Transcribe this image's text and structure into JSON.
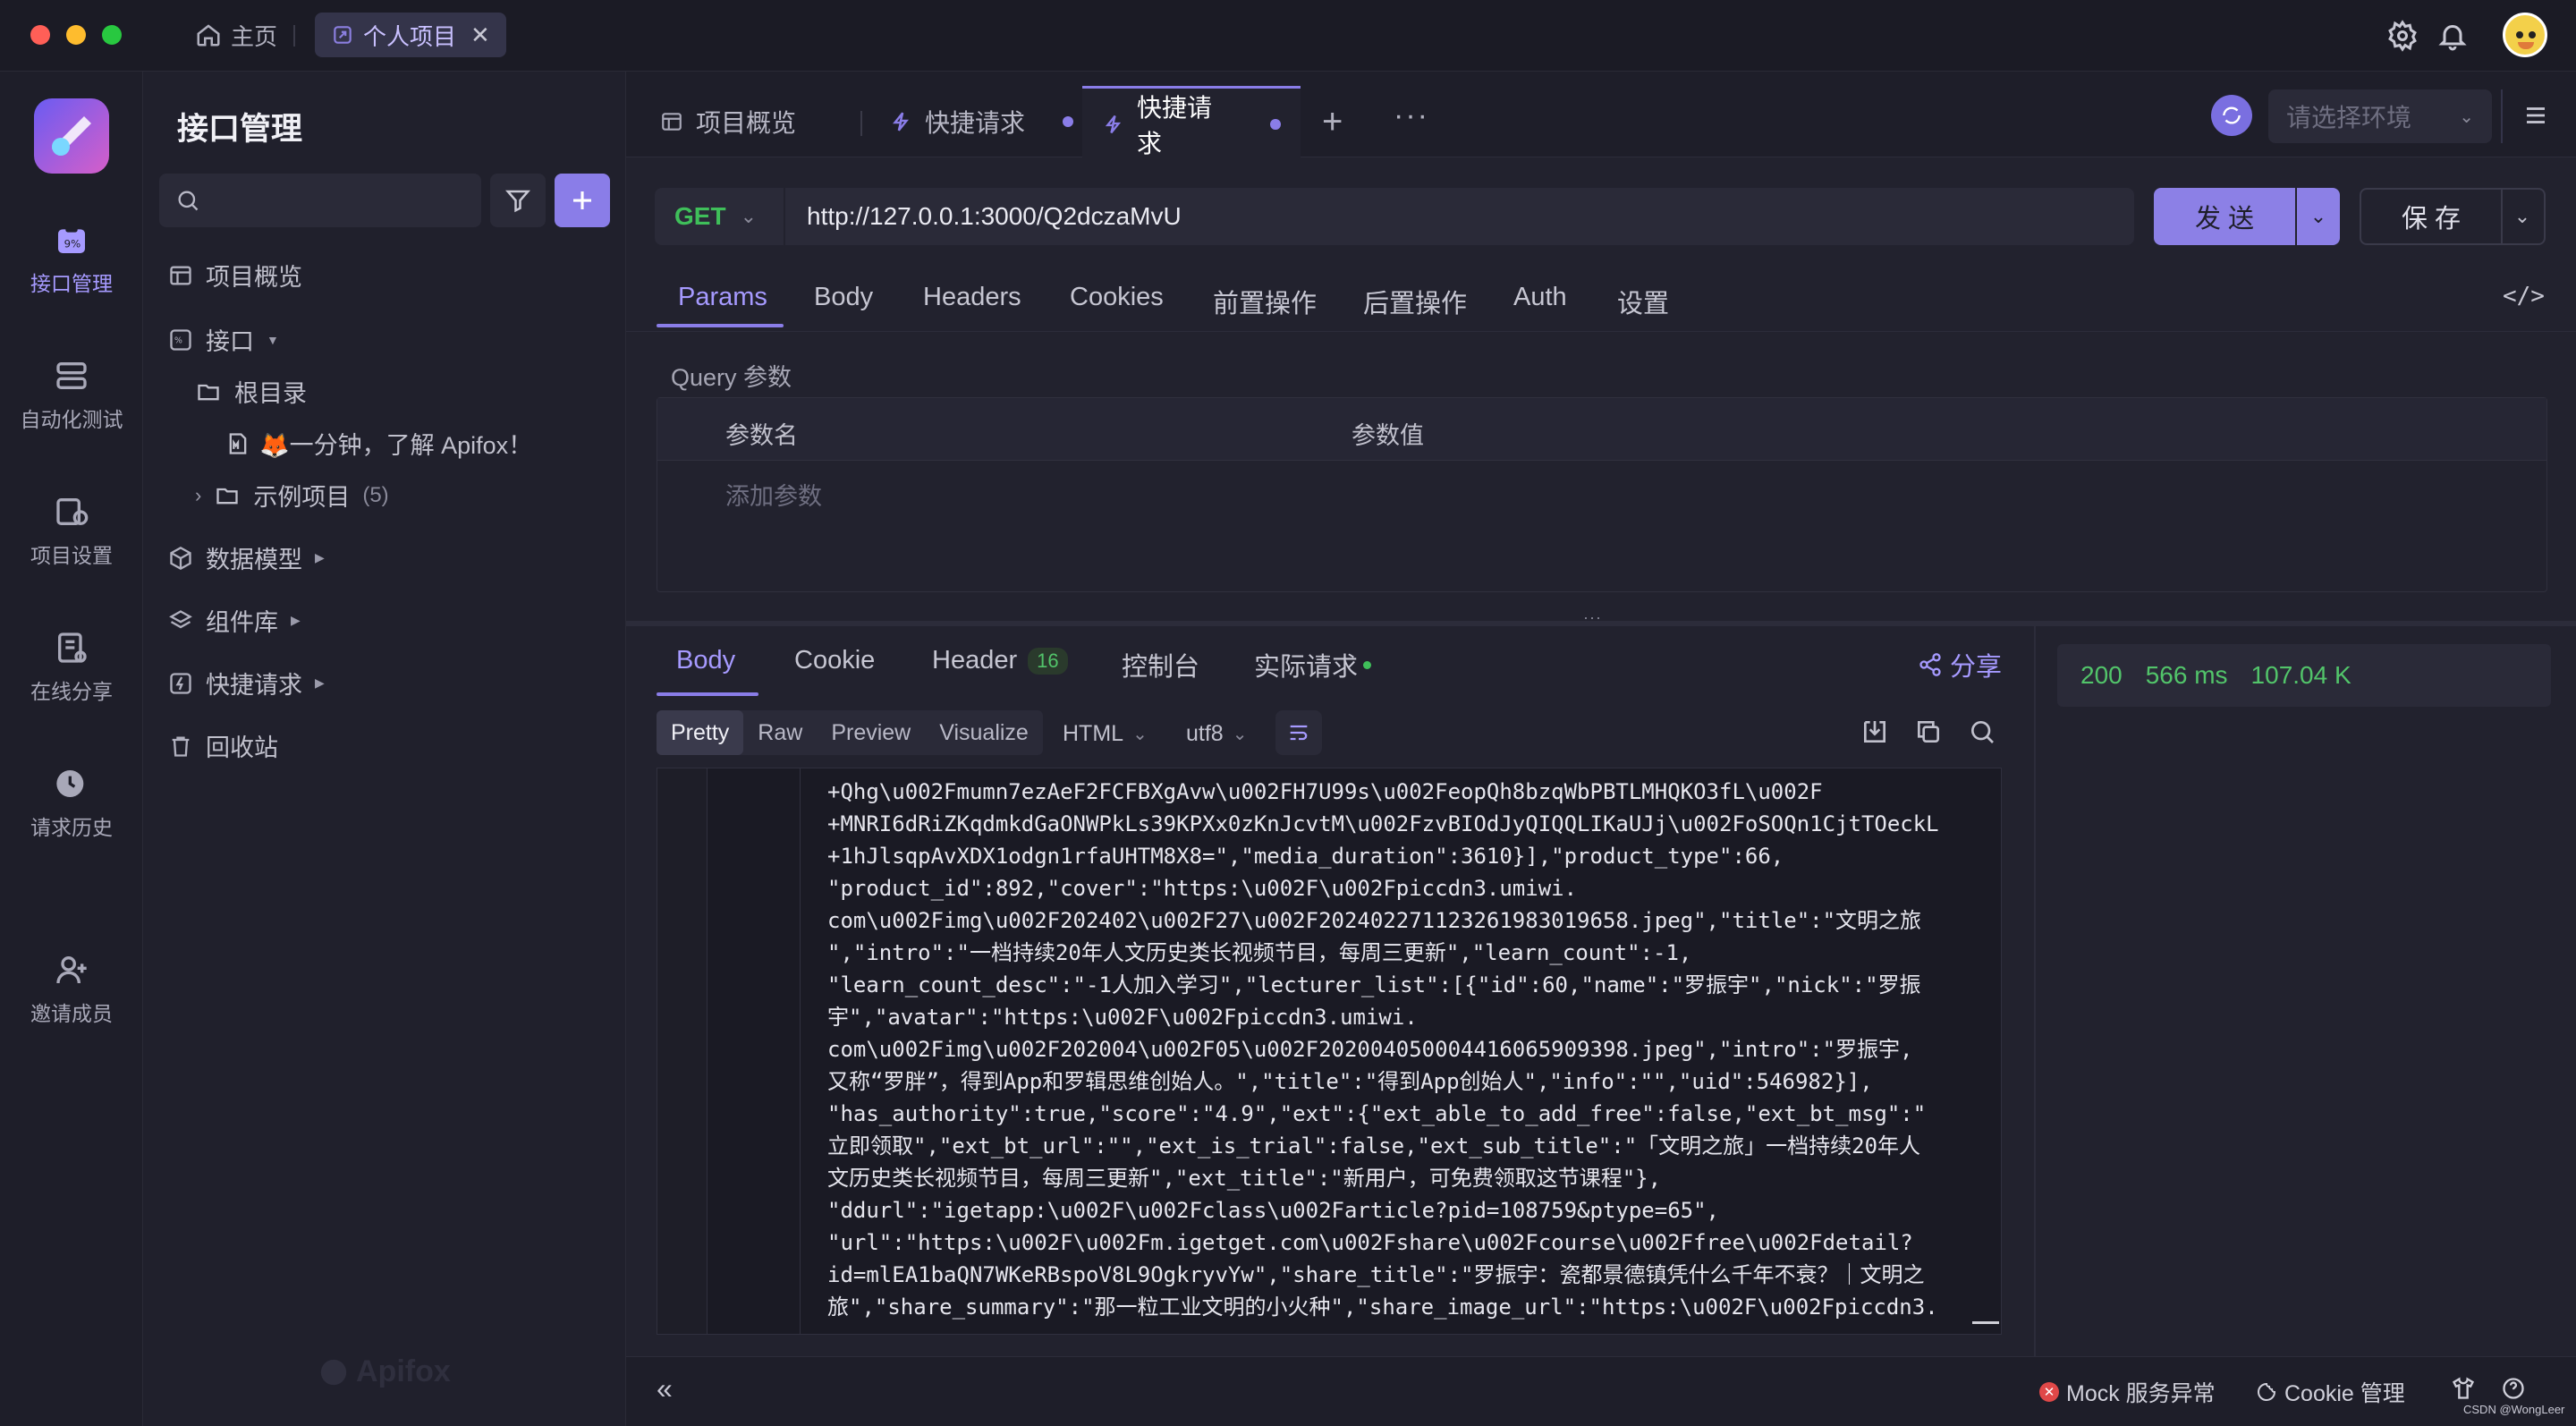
{
  "titlebar": {
    "home_tab": "主页",
    "project_tab": "个人项目"
  },
  "rail": {
    "items": [
      {
        "label": "接口管理",
        "icon": "api-management-icon"
      },
      {
        "label": "自动化测试",
        "icon": "automation-test-icon"
      },
      {
        "label": "项目设置",
        "icon": "project-settings-icon"
      },
      {
        "label": "在线分享",
        "icon": "online-share-icon"
      },
      {
        "label": "请求历史",
        "icon": "request-history-icon"
      },
      {
        "label": "邀请成员",
        "icon": "invite-member-icon"
      }
    ]
  },
  "sidebar": {
    "title": "接口管理",
    "search_placeholder": "",
    "items": {
      "overview": "项目概览",
      "api": "接口",
      "root": "根目录",
      "doc": "🦊一分钟，了解 Apifox！",
      "examples": "示例项目",
      "examples_count": "(5)",
      "data_models": "数据模型",
      "components": "组件库",
      "quick_requests": "快捷请求",
      "recycle": "回收站"
    },
    "watermark": "Apifox"
  },
  "main": {
    "tabs": {
      "overview": "项目概览",
      "quick1": "快捷请求",
      "quick2": "快捷请求"
    },
    "env_placeholder": "请选择环境",
    "request": {
      "method": "GET",
      "url": "http://127.0.0.1:3000/Q2dczaMvU",
      "send": "发 送",
      "save": "保 存"
    },
    "req_tabs": [
      "Params",
      "Body",
      "Headers",
      "Cookies",
      "前置操作",
      "后置操作",
      "Auth",
      "设置"
    ],
    "query_label": "Query 参数",
    "table": {
      "col_name": "参数名",
      "col_value": "参数值",
      "add_placeholder": "添加参数"
    },
    "resp_tabs": {
      "body": "Body",
      "cookie": "Cookie",
      "header": "Header",
      "header_count": "16",
      "console": "控制台",
      "actual": "实际请求",
      "share": "分享"
    },
    "format": {
      "pretty": "Pretty",
      "raw": "Raw",
      "preview": "Preview",
      "visualize": "Visualize",
      "lang": "HTML",
      "encoding": "utf8"
    },
    "code_lines": [
      "+Qhg\\u002Fmumn7ezAeF2FCFBXgAvw\\u002FH7U99s\\u002FeopQh8bzqWbPBTLMHQKO3fL\\u002F",
      "+MNRI6dRiZKqdmkdGaONWPkLs39KPXx0zKnJcvtM\\u002FzvBIOdJyQIQQLIKaUJj\\u002FoSOQn1CjtTOeckL",
      "+1hJlsqpAvXDX1odgn1rfaUHTM8X8=\",\"media_duration\":3610}],\"product_type\":66,",
      "\"product_id\":892,\"cover\":\"https:\\u002F\\u002Fpiccdn3.umiwi.",
      "com\\u002Fimg\\u002F202402\\u002F27\\u002F20240227112326198301965​8.jpeg\",\"title\":\"文明之旅",
      "\",\"intro\":\"一档持续20年人文历史类长视频节目，每周三更新\",\"learn_count\":-1,",
      "\"learn_count_desc\":\"-1人加入学习\",\"lecturer_list\":[{\"id\":60,\"name\":\"罗振宇\",\"nick\":\"罗振",
      "宇\",\"avatar\":\"https:\\u002F\\u002Fpiccdn3.umiwi.",
      "com\\u002Fimg\\u002F202004\\u002F05\\u002F20200405000441606590939​8.jpeg\",\"intro\":\"罗振宇,",
      "又称“罗胖”，得到App和罗辑思维创始人。\",\"title\":\"得到App创始人\",\"info\":\"\",\"uid\":546982}],",
      "\"has_authority\":true,\"score\":\"4.9\",\"ext\":{\"ext_able_to_add_free\":false,\"ext_bt_msg\":\"",
      "立即领取\",\"ext_bt_url\":\"\",\"ext_is_trial\":false,\"ext_sub_title\":\"「文明之旅」一档持续20年人",
      "文历史类长视频节目，每周三更新\",\"ext_title\":\"新用户，可免费领取这节课程\"},",
      "\"ddurl\":\"igetapp:\\u002F\\u002Fclass\\u002Farticle?pid=108759&ptype=65\",",
      "\"url\":\"https:\\u002F\\u002Fm.igetget.com\\u002Fshare\\u002Fcourse\\u002Ffree\\u002Fdetail?",
      "id=mlEA1baQN7WKeRBspoV8L9OgkryvYw\",\"share_title\":\"罗振宇：瓷都景德镇凭什么千年不衰？｜文明之",
      "旅\",\"share_summary\":\"那一粒工业文明的小火种\",\"share_image_url\":\"https:\\u002F\\u002Fpiccdn3."
    ],
    "status": {
      "code": "200",
      "time": "566 ms",
      "size": "107.04 K"
    },
    "footer": {
      "mock": "Mock 服务异常",
      "cookie": "Cookie 管理",
      "credit": "CSDN @WongLeer"
    }
  }
}
